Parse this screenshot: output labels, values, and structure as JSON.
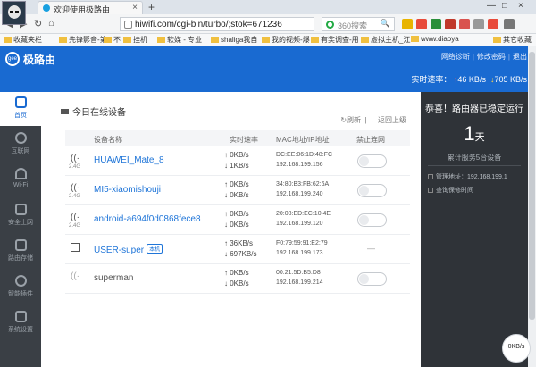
{
  "browser": {
    "tab_title": "欢迎使用极路由",
    "tab_close": "×",
    "new_tab": "+",
    "window_controls": [
      "—",
      "□",
      "×"
    ],
    "url": "hiwifi.com/cgi-bin/turbo/;stok=671236",
    "search_placeholder": "360搜索",
    "search_glyph": "🔍",
    "bookmarks": [
      "收藏夹栏",
      "先锋影音-第1",
      "不",
      "挂机",
      "软媒 - 专业",
      "shaliga我自",
      "我的视频-爆",
      "有奖调查-用",
      "虚拟主机_江",
      "www.diaoya",
      "其它收藏"
    ]
  },
  "router": {
    "logo_text": "gee",
    "brand": "极路由",
    "links": [
      "网络诊断",
      "修改密码",
      "退出"
    ],
    "rate_label": "实时速率：",
    "rate_up": "46 KB/s",
    "rate_down": "705 KB/s"
  },
  "nav": {
    "items": [
      {
        "label": "首页",
        "icon": "home-icon"
      },
      {
        "label": "互联网",
        "icon": "globe-icon"
      },
      {
        "label": "Wi-Fi",
        "icon": "wifi-icon"
      },
      {
        "label": "安全上网",
        "icon": "lock-icon"
      },
      {
        "label": "路由存储",
        "icon": "folder-icon"
      },
      {
        "label": "智能插件",
        "icon": "puzzle-icon"
      },
      {
        "label": "系统设置",
        "icon": "wrench-icon"
      }
    ]
  },
  "main": {
    "title": "今日在线设备",
    "refresh": "刷新",
    "back": "返回上级",
    "headers": {
      "name": "设备名称",
      "rate": "实时速率",
      "mac": "MAC地址/IP地址",
      "block": "禁止连网"
    },
    "devices": [
      {
        "band": "2.4G",
        "name": "HUAWEI_Mate_8",
        "up": "0KB/s",
        "down": "1KB/s",
        "mac": "DC:EE:06:1D:48:FC",
        "ip": "192.168.199.156",
        "badge": ""
      },
      {
        "band": "2.4G",
        "name": "MI5-xiaomishouji",
        "up": "0KB/s",
        "down": "0KB/s",
        "mac": "34:80:B3:FB:62:6A",
        "ip": "192.168.199.240",
        "badge": ""
      },
      {
        "band": "2.4G",
        "name": "android-a694f0d0868fece8",
        "up": "0KB/s",
        "down": "0KB/s",
        "mac": "20:08:ED:EC:10:4E",
        "ip": "192.168.199.120",
        "badge": ""
      },
      {
        "band": "",
        "name": "USER-super",
        "up": "36KB/s",
        "down": "697KB/s",
        "mac": "F0:79:59:91:E2:79",
        "ip": "192.168.199.173",
        "badge": "本机"
      },
      {
        "band": "",
        "name": "superman",
        "up": "0KB/s",
        "down": "0KB/s",
        "mac": "00:21:5D:B5:D8",
        "ip": "192.168.199.214",
        "badge": ""
      }
    ],
    "self_dash": "—"
  },
  "status": {
    "congrats": "恭喜！路由器已稳定运行",
    "uptime_value": "1",
    "uptime_unit": "天",
    "served": "累计服务5台设备",
    "admin": "管理地址：192.168.199.1",
    "warranty": "查询保修时间"
  },
  "bubble": "0KB/s",
  "colors": {
    "header": "#196ad1",
    "sidebar": "#3a3f45",
    "panel": "#2f3338",
    "link": "#1f75d8"
  }
}
